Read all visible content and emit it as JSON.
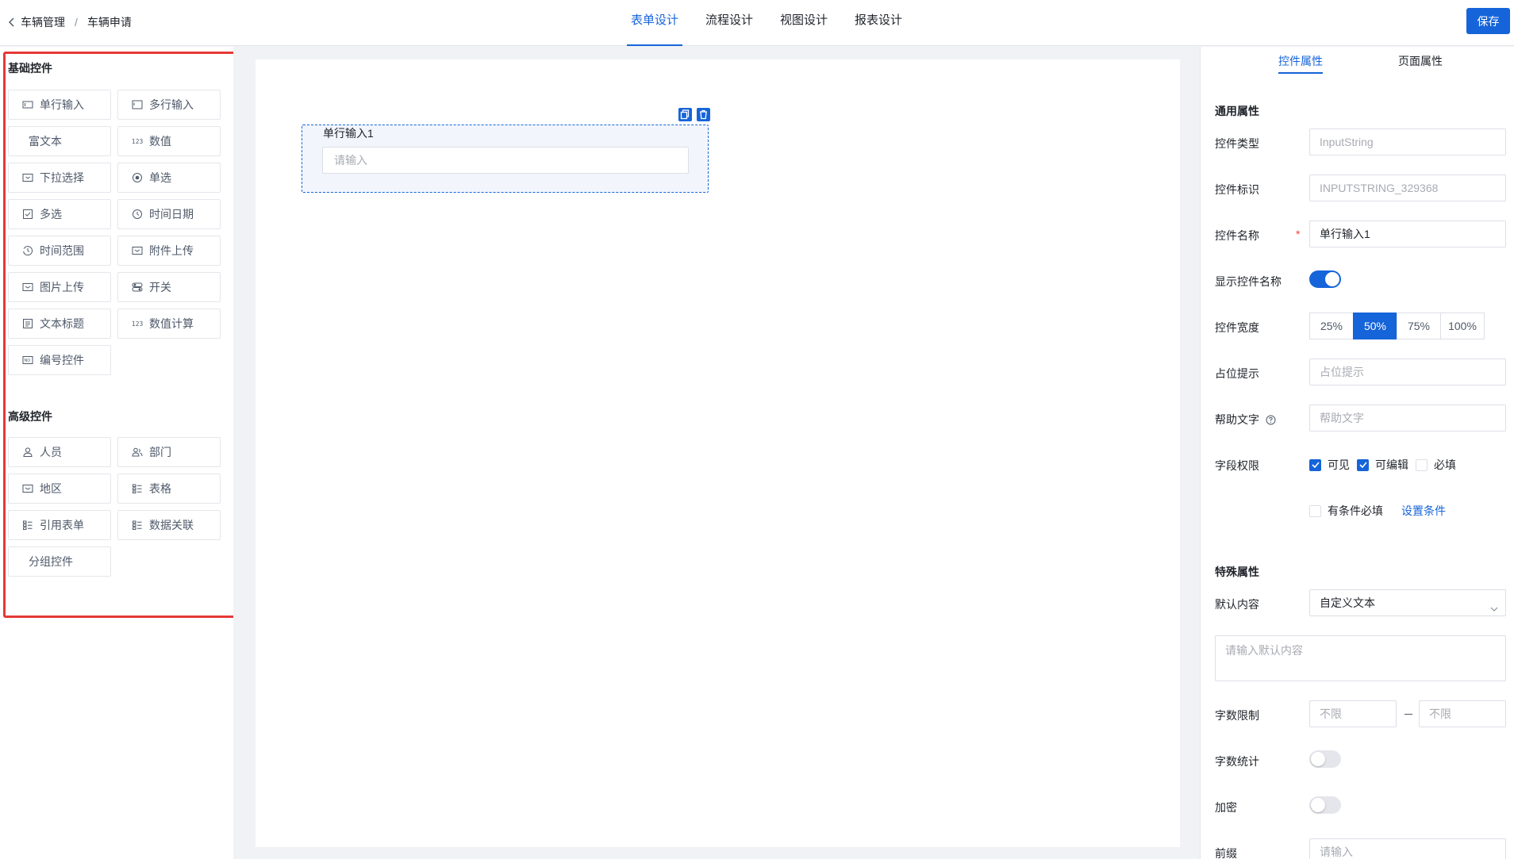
{
  "breadcrumb": {
    "level1": "车辆管理",
    "separator": "/",
    "level2": "车辆申请"
  },
  "tabs": [
    "表单设计",
    "流程设计",
    "视图设计",
    "报表设计"
  ],
  "active_tab": "表单设计",
  "save_label": "保存",
  "left_panel": {
    "basic_title": "基础控件",
    "basic": [
      {
        "label": "单行输入",
        "icon": "single-line-input-icon"
      },
      {
        "label": "多行输入",
        "icon": "multi-line-input-icon"
      },
      {
        "label": "富文本",
        "icon": ""
      },
      {
        "label": "数值",
        "icon": "number-123-icon"
      },
      {
        "label": "下拉选择",
        "icon": "dropdown-icon"
      },
      {
        "label": "单选",
        "icon": "radio-icon"
      },
      {
        "label": "多选",
        "icon": "checkbox-icon"
      },
      {
        "label": "时间日期",
        "icon": "clock-icon"
      },
      {
        "label": "时间范围",
        "icon": "time-range-icon"
      },
      {
        "label": "附件上传",
        "icon": "attachment-icon"
      },
      {
        "label": "图片上传",
        "icon": "image-icon"
      },
      {
        "label": "开关",
        "icon": "switch-icon"
      },
      {
        "label": "文本标题",
        "icon": "text-title-icon"
      },
      {
        "label": "数值计算",
        "icon": "number-123-icon"
      },
      {
        "label": "编号控件",
        "icon": "serial-number-icon"
      }
    ],
    "advanced_title": "高级控件",
    "advanced": [
      {
        "label": "人员",
        "icon": "person-icon"
      },
      {
        "label": "部门",
        "icon": "department-icon"
      },
      {
        "label": "地区",
        "icon": "region-icon"
      },
      {
        "label": "表格",
        "icon": "table-icon"
      },
      {
        "label": "引用表单",
        "icon": "reference-form-icon"
      },
      {
        "label": "数据关联",
        "icon": "data-link-icon"
      },
      {
        "label": "分组控件",
        "icon": ""
      }
    ]
  },
  "canvas": {
    "field_label": "单行输入1",
    "field_placeholder": "请输入"
  },
  "right_panel": {
    "tabs": [
      "控件属性",
      "页面属性"
    ],
    "active_tab": "控件属性",
    "general_title": "通用属性",
    "type_label": "控件类型",
    "type_value": "InputString",
    "id_label": "控件标识",
    "id_value": "INPUTSTRING_329368",
    "name_label": "控件名称",
    "required_mark": "*",
    "name_value": "单行输入1",
    "show_name_label": "显示控件名称",
    "show_name_on": true,
    "width_label": "控件宽度",
    "width_options": [
      "25%",
      "50%",
      "75%",
      "100%"
    ],
    "width_selected": "50%",
    "placeholder_label": "占位提示",
    "placeholder_placeholder": "占位提示",
    "help_label": "帮助文字",
    "help_placeholder": "帮助文字",
    "perm_label": "字段权限",
    "perm_visible": "可见",
    "perm_editable": "可编辑",
    "perm_required": "必填",
    "perm_visible_checked": true,
    "perm_editable_checked": true,
    "perm_required_checked": false,
    "cond_required": "有条件必填",
    "cond_required_checked": false,
    "set_condition": "设置条件",
    "special_title": "特殊属性",
    "default_label": "默认内容",
    "default_value": "自定义文本",
    "default_text_placeholder": "请输入默认内容",
    "limit_label": "字数限制",
    "limit_min_placeholder": "不限",
    "limit_max_placeholder": "不限",
    "count_label": "字数统计",
    "count_on": false,
    "encrypt_label": "加密",
    "encrypt_on": false,
    "prefix_label": "前缀",
    "prefix_placeholder": "请输入"
  },
  "colors": {
    "primary": "#1664d9",
    "highlight_outline": "#e53935"
  }
}
